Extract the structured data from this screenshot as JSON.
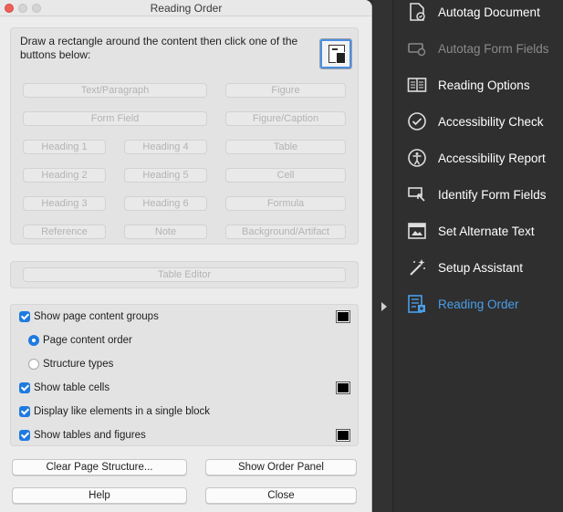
{
  "window": {
    "title": "Reading Order"
  },
  "instructions": "Draw a rectangle around the content then click one of the buttons below:",
  "tag_buttons": {
    "text_paragraph": "Text/Paragraph",
    "figure": "Figure",
    "form_field": "Form Field",
    "figure_caption": "Figure/Caption",
    "heading1": "Heading 1",
    "heading4": "Heading 4",
    "table": "Table",
    "heading2": "Heading 2",
    "heading5": "Heading 5",
    "cell": "Cell",
    "heading3": "Heading 3",
    "heading6": "Heading 6",
    "formula": "Formula",
    "reference": "Reference",
    "note": "Note",
    "background_artifact": "Background/Artifact"
  },
  "table_editor": "Table Editor",
  "options": {
    "show_page_content_groups": {
      "label": "Show page content groups",
      "checked": true
    },
    "page_content_order": {
      "label": "Page content order",
      "selected": true
    },
    "structure_types": {
      "label": "Structure types",
      "selected": false
    },
    "show_table_cells": {
      "label": "Show table cells",
      "checked": true
    },
    "display_like_elements": {
      "label": "Display like elements in a single block",
      "checked": true
    },
    "show_tables_figures": {
      "label": "Show tables and figures",
      "checked": true
    },
    "swatch_color": "#000000"
  },
  "buttons": {
    "clear_page_structure": "Clear Page Structure...",
    "show_order_panel": "Show Order Panel",
    "help": "Help",
    "close": "Close"
  },
  "side_panel": {
    "items": [
      {
        "label": "Autotag Document",
        "icon": "autotag-document-icon",
        "state": "normal"
      },
      {
        "label": "Autotag Form Fields",
        "icon": "autotag-form-fields-icon",
        "state": "disabled"
      },
      {
        "label": "Reading Options",
        "icon": "reading-options-icon",
        "state": "normal"
      },
      {
        "label": "Accessibility Check",
        "icon": "accessibility-check-icon",
        "state": "normal"
      },
      {
        "label": "Accessibility Report",
        "icon": "accessibility-report-icon",
        "state": "normal"
      },
      {
        "label": "Identify Form Fields",
        "icon": "identify-form-fields-icon",
        "state": "normal"
      },
      {
        "label": "Set Alternate Text",
        "icon": "set-alternate-text-icon",
        "state": "normal"
      },
      {
        "label": "Setup Assistant",
        "icon": "setup-assistant-icon",
        "state": "normal"
      },
      {
        "label": "Reading Order",
        "icon": "reading-order-icon",
        "state": "active"
      }
    ],
    "active_color": "#4a9eea"
  }
}
